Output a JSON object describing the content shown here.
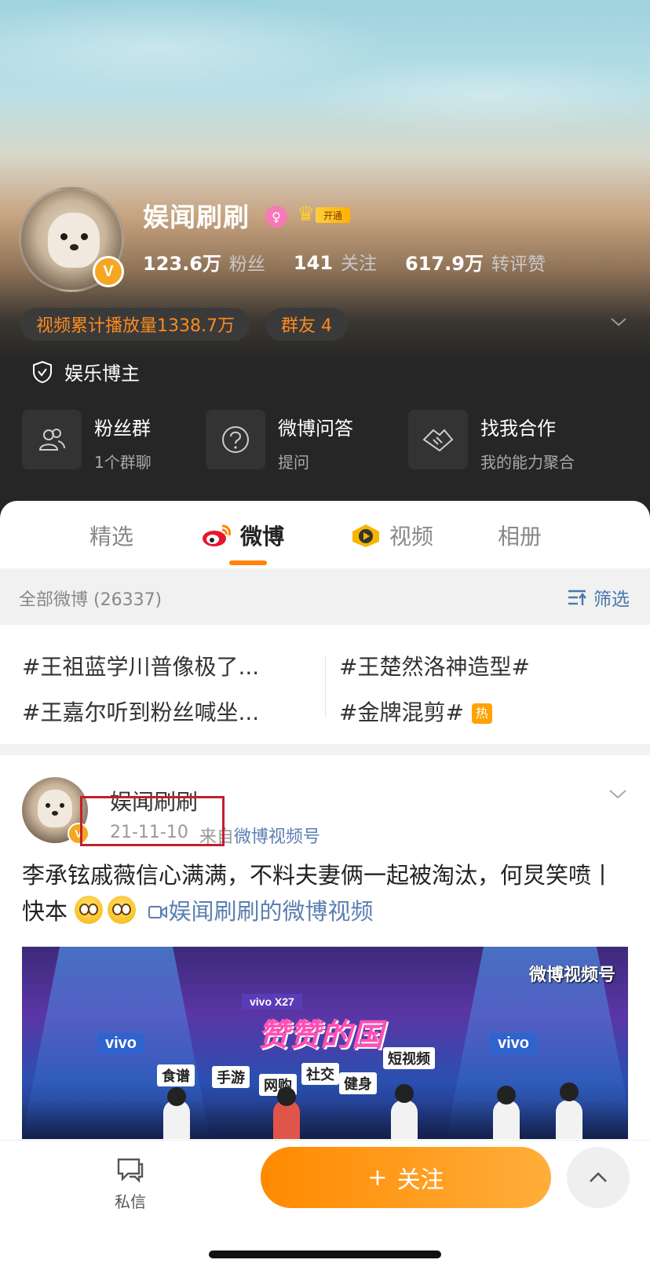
{
  "profile": {
    "name": "娱闻刷刷",
    "verified_mark": "V",
    "vip_label": "开通",
    "stats": [
      {
        "value": "123.6万",
        "label": "粉丝"
      },
      {
        "value": "141",
        "label": "关注"
      },
      {
        "value": "617.9万",
        "label": "转评赞"
      }
    ],
    "chips": [
      "视频累计播放量1338.7万",
      "群友 4"
    ],
    "role": "娱乐博主",
    "services": [
      {
        "title": "粉丝群",
        "sub": "1个群聊",
        "icon": "people-icon"
      },
      {
        "title": "微博问答",
        "sub": "提问",
        "icon": "question-icon"
      },
      {
        "title": "找我合作",
        "sub": "我的能力聚合",
        "icon": "handshake-icon"
      }
    ]
  },
  "tabs": [
    "精选",
    "微博",
    "视频",
    "相册"
  ],
  "active_tab": "微博",
  "filter": {
    "label": "全部微博 (26337)",
    "button": "筛选"
  },
  "topics": [
    "#王祖蓝学川普像极了...",
    "#王楚然洛神造型#",
    "#王嘉尔听到粉丝喊坐...",
    "#金牌混剪#"
  ],
  "hot_label": "热",
  "post": {
    "author": "娱闻刷刷",
    "date": "21-11-10",
    "source_prefix": "来自",
    "source": "微博视频号",
    "text": "李承铉戚薇信心满满，不料夫妻俩一起被淘汰，何炅笑喷丨快本",
    "video_link": "娱闻刷刷的微博视频",
    "video": {
      "vivo_label": "vivo",
      "vivo_model": "vivo X27",
      "show_title": "赞赞的国",
      "stage_words": [
        "食谱",
        "手游",
        "网购",
        "社交",
        "健身",
        "短视频"
      ],
      "watermark": "微博视频号"
    }
  },
  "bottom": {
    "dm": "私信",
    "follow": "关注",
    "follow_plus": "+"
  },
  "colors": {
    "accent": "#ff8200",
    "link": "#5b7fb0",
    "verified": "#f5a623",
    "highlight": "#c0222e"
  }
}
